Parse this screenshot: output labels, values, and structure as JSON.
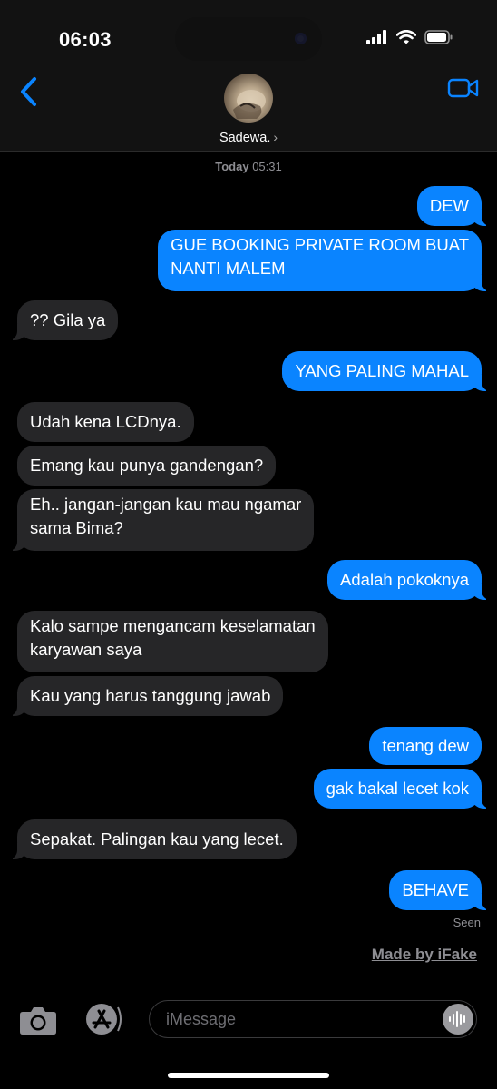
{
  "status_bar": {
    "time": "06:03"
  },
  "header": {
    "contact_name": "Sadewa.",
    "chevron": "›",
    "back_icon": "chevron-left-icon",
    "video_icon": "video-camera-icon"
  },
  "conversation": {
    "timestamp_day": "Today",
    "timestamp_time": "05:31",
    "messages": [
      {
        "from": "me",
        "text": "DEW"
      },
      {
        "from": "me",
        "text": "GUE BOOKING PRIVATE ROOM BUAT\nNANTI MALEM"
      },
      {
        "from": "them",
        "text": "?? Gila ya"
      },
      {
        "from": "me",
        "text": "YANG PALING MAHAL"
      },
      {
        "from": "them",
        "text": "Udah kena LCDnya."
      },
      {
        "from": "them",
        "text": "Emang kau punya gandengan?"
      },
      {
        "from": "them",
        "text": "Eh.. jangan-jangan kau mau ngamar\nsama Bima?"
      },
      {
        "from": "me",
        "text": "Adalah pokoknya"
      },
      {
        "from": "them",
        "text": "Kalo sampe mengancam keselamatan\nkaryawan saya"
      },
      {
        "from": "them",
        "text": "Kau yang harus tanggung jawab"
      },
      {
        "from": "me",
        "text": "tenang dew"
      },
      {
        "from": "me",
        "text": "gak bakal lecet kok"
      },
      {
        "from": "them",
        "text": "Sepakat. Palingan kau yang lecet."
      },
      {
        "from": "me",
        "text": "BEHAVE"
      }
    ],
    "read_receipt": "Seen",
    "watermark": "Made by iFake"
  },
  "input_bar": {
    "placeholder": "iMessage",
    "camera_icon": "camera-icon",
    "apps_icon": "app-store-icon",
    "audio_icon": "audio-waveform-icon"
  },
  "colors": {
    "outgoing_bubble": "#0a84ff",
    "incoming_bubble": "#262628",
    "accent": "#0a84ff",
    "background": "#000000"
  }
}
